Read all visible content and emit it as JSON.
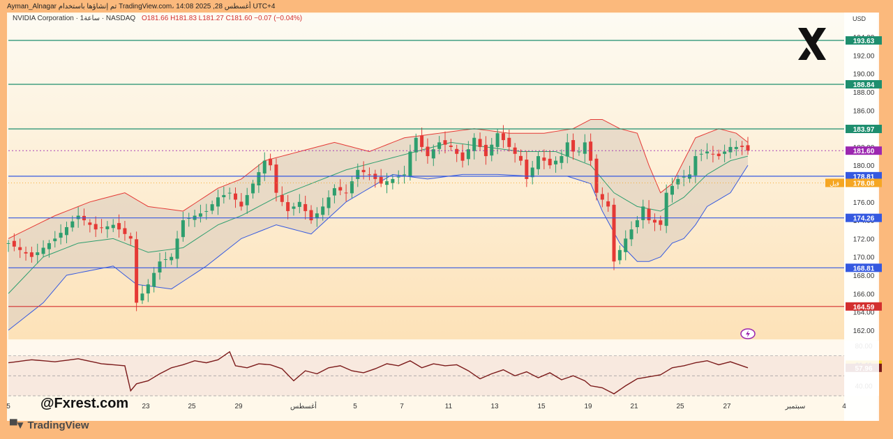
{
  "header": {
    "author_line": "Ayman_Alnagar تم إنشاؤها باستخدام TradingView.com، أغسطس 28, 2025 14:08 UTC+4",
    "symbol_line": "NVIDIA Corporation · 1ساعة · NASDAQ",
    "ohlc": "O181.66  H181.83  L181.27  C181.60  −0.07 (−0.04%)",
    "currency": "USD"
  },
  "watermark": "@Fxrest.com",
  "brand": "TradingView",
  "chart_data": [
    {
      "type": "candlestick",
      "title": "NVIDIA Corporation · 1ساعة · NASDAQ",
      "currency": "USD",
      "ylim": [
        161,
        195
      ],
      "y_ticks": [
        162,
        164,
        166,
        168,
        170,
        172,
        174,
        176,
        178,
        180,
        182,
        184,
        186,
        188,
        190,
        192,
        194
      ],
      "x_ticks": [
        "5",
        "23",
        "25",
        "29",
        "أغسطس",
        "5",
        "7",
        "11",
        "13",
        "15",
        "19",
        "21",
        "25",
        "27",
        "سبتمبر",
        "4"
      ],
      "price_lines": [
        {
          "value": 193.63,
          "label": "193.63",
          "color": "#1e8e6e"
        },
        {
          "value": 188.84,
          "label": "188.84",
          "color": "#1e8e6e"
        },
        {
          "value": 183.97,
          "label": "183.97",
          "color": "#1e8e6e"
        },
        {
          "value": 178.81,
          "label": "178.81",
          "color": "#3559e0"
        },
        {
          "value": 174.26,
          "label": "174.26",
          "color": "#3559e0"
        },
        {
          "value": 168.81,
          "label": "168.81",
          "color": "#3559e0"
        },
        {
          "value": 164.59,
          "label": "164.59",
          "color": "#d32f2f"
        }
      ],
      "markers": [
        {
          "value": 181.6,
          "label": "181.60",
          "color": "#9c27b0",
          "note": ""
        },
        {
          "value": 178.08,
          "label": "178.08",
          "color": "#f5a623",
          "note": "قبل"
        }
      ],
      "price_path": [
        [
          0,
          171.5
        ],
        [
          4,
          170
        ],
        [
          8,
          172
        ],
        [
          12,
          174.5
        ],
        [
          15,
          173
        ],
        [
          18,
          173.5
        ],
        [
          21,
          172
        ],
        [
          22,
          165
        ],
        [
          24,
          167
        ],
        [
          26,
          169.5
        ],
        [
          28,
          170
        ],
        [
          30,
          174
        ],
        [
          32,
          174.5
        ],
        [
          34,
          175
        ],
        [
          36,
          176.5
        ],
        [
          38,
          177
        ],
        [
          40,
          175.5
        ],
        [
          42,
          178
        ],
        [
          44,
          180.5
        ],
        [
          45,
          180
        ],
        [
          46,
          177
        ],
        [
          48,
          175
        ],
        [
          50,
          176
        ],
        [
          52,
          174
        ],
        [
          54,
          175.5
        ],
        [
          56,
          177.5
        ],
        [
          58,
          177
        ],
        [
          60,
          179.5
        ],
        [
          62,
          179
        ],
        [
          64,
          178
        ],
        [
          66,
          178.5
        ],
        [
          68,
          179
        ],
        [
          69,
          181.5
        ],
        [
          70,
          183
        ],
        [
          72,
          181
        ],
        [
          74,
          182.5
        ],
        [
          76,
          182
        ],
        [
          78,
          180.5
        ],
        [
          80,
          183
        ],
        [
          82,
          181
        ],
        [
          84,
          183.5
        ],
        [
          86,
          182
        ],
        [
          88,
          180.5
        ],
        [
          89,
          178.5
        ],
        [
          91,
          181
        ],
        [
          93,
          180
        ],
        [
          95,
          181
        ],
        [
          96,
          182.5
        ],
        [
          97,
          181.5
        ],
        [
          98,
          181.5
        ],
        [
          99,
          182.5
        ],
        [
          100,
          180.5
        ],
        [
          101,
          177
        ],
        [
          103,
          175.5
        ],
        [
          104,
          169.5
        ],
        [
          106,
          172
        ],
        [
          108,
          174
        ],
        [
          109,
          175.5
        ],
        [
          110,
          174
        ],
        [
          112,
          173.5
        ],
        [
          113,
          177
        ],
        [
          115,
          178.5
        ],
        [
          117,
          179
        ],
        [
          118,
          181
        ],
        [
          120,
          181.5
        ],
        [
          122,
          181
        ],
        [
          124,
          182
        ],
        [
          126,
          182
        ],
        [
          127,
          181.6
        ]
      ],
      "bollinger": {
        "upper": [
          [
            0,
            172
          ],
          [
            8,
            174.5
          ],
          [
            14,
            176
          ],
          [
            20,
            177
          ],
          [
            24,
            175.5
          ],
          [
            30,
            175
          ],
          [
            36,
            177.5
          ],
          [
            40,
            178.5
          ],
          [
            44,
            180.5
          ],
          [
            50,
            181.5
          ],
          [
            56,
            182.5
          ],
          [
            62,
            181.5
          ],
          [
            68,
            183
          ],
          [
            74,
            183.5
          ],
          [
            80,
            184
          ],
          [
            86,
            183.5
          ],
          [
            92,
            183.5
          ],
          [
            97,
            184
          ],
          [
            100,
            185
          ],
          [
            102,
            185
          ],
          [
            105,
            184
          ],
          [
            108,
            183.5
          ],
          [
            110,
            180
          ],
          [
            112,
            177
          ],
          [
            114,
            178
          ],
          [
            118,
            183
          ],
          [
            122,
            184
          ],
          [
            125,
            183.5
          ],
          [
            127,
            182.5
          ]
        ],
        "middle": [
          [
            0,
            166
          ],
          [
            6,
            170
          ],
          [
            12,
            171.5
          ],
          [
            18,
            172
          ],
          [
            24,
            170.5
          ],
          [
            30,
            171
          ],
          [
            36,
            173.5
          ],
          [
            40,
            174.5
          ],
          [
            46,
            176.5
          ],
          [
            52,
            178
          ],
          [
            58,
            179.5
          ],
          [
            64,
            180.5
          ],
          [
            70,
            181.5
          ],
          [
            76,
            182.5
          ],
          [
            82,
            182
          ],
          [
            88,
            181.5
          ],
          [
            94,
            181.5
          ],
          [
            100,
            180
          ],
          [
            104,
            177
          ],
          [
            108,
            175.5
          ],
          [
            112,
            175
          ],
          [
            116,
            176.5
          ],
          [
            120,
            179
          ],
          [
            124,
            180.5
          ],
          [
            127,
            181
          ]
        ],
        "lower": [
          [
            0,
            162
          ],
          [
            6,
            165
          ],
          [
            10,
            168
          ],
          [
            14,
            168.5
          ],
          [
            18,
            169
          ],
          [
            22,
            167
          ],
          [
            28,
            166.5
          ],
          [
            34,
            169
          ],
          [
            40,
            172
          ],
          [
            46,
            173.5
          ],
          [
            52,
            172.5
          ],
          [
            58,
            176
          ],
          [
            62,
            177.5
          ],
          [
            66,
            179
          ],
          [
            72,
            178.5
          ],
          [
            78,
            179
          ],
          [
            84,
            179
          ],
          [
            90,
            178.8
          ],
          [
            96,
            178.8
          ],
          [
            100,
            178
          ],
          [
            102,
            175
          ],
          [
            105,
            171.5
          ],
          [
            108,
            169.5
          ],
          [
            110,
            169.5
          ],
          [
            112,
            170
          ],
          [
            114,
            171.5
          ],
          [
            116,
            172
          ],
          [
            118,
            173.5
          ],
          [
            120,
            175.5
          ],
          [
            124,
            177
          ],
          [
            127,
            180
          ]
        ]
      },
      "last_index": 127
    },
    {
      "type": "line",
      "title": "",
      "ylim": [
        30,
        85
      ],
      "y_ticks": [
        40.0,
        80.0
      ],
      "levels": [
        {
          "value": 61.11,
          "label": "61.11",
          "color": "#f1c40f"
        },
        {
          "value": 57.96,
          "label": "57.96",
          "color": "#7b1a1a"
        }
      ],
      "band": [
        30,
        70
      ],
      "values": [
        [
          0,
          63
        ],
        [
          4,
          66
        ],
        [
          8,
          64
        ],
        [
          12,
          67
        ],
        [
          16,
          62
        ],
        [
          20,
          60
        ],
        [
          21,
          35
        ],
        [
          22,
          42
        ],
        [
          24,
          45
        ],
        [
          26,
          52
        ],
        [
          28,
          58
        ],
        [
          30,
          61
        ],
        [
          32,
          65
        ],
        [
          34,
          63
        ],
        [
          36,
          66
        ],
        [
          38,
          74
        ],
        [
          39,
          60
        ],
        [
          41,
          58
        ],
        [
          43,
          62
        ],
        [
          45,
          61
        ],
        [
          47,
          57
        ],
        [
          49,
          45
        ],
        [
          51,
          55
        ],
        [
          53,
          52
        ],
        [
          55,
          58
        ],
        [
          57,
          60
        ],
        [
          59,
          55
        ],
        [
          61,
          53
        ],
        [
          63,
          57
        ],
        [
          65,
          62
        ],
        [
          67,
          60
        ],
        [
          69,
          65
        ],
        [
          71,
          58
        ],
        [
          73,
          62
        ],
        [
          75,
          60
        ],
        [
          77,
          61
        ],
        [
          79,
          55
        ],
        [
          81,
          47
        ],
        [
          83,
          52
        ],
        [
          85,
          56
        ],
        [
          87,
          50
        ],
        [
          89,
          54
        ],
        [
          91,
          48
        ],
        [
          93,
          53
        ],
        [
          95,
          46
        ],
        [
          97,
          50
        ],
        [
          99,
          45
        ],
        [
          100,
          40
        ],
        [
          102,
          38
        ],
        [
          104,
          32
        ],
        [
          106,
          40
        ],
        [
          108,
          47
        ],
        [
          110,
          49
        ],
        [
          112,
          51
        ],
        [
          114,
          58
        ],
        [
          116,
          60
        ],
        [
          118,
          63
        ],
        [
          120,
          65
        ],
        [
          122,
          61
        ],
        [
          124,
          64
        ],
        [
          126,
          60
        ],
        [
          127,
          57.96
        ]
      ]
    }
  ]
}
